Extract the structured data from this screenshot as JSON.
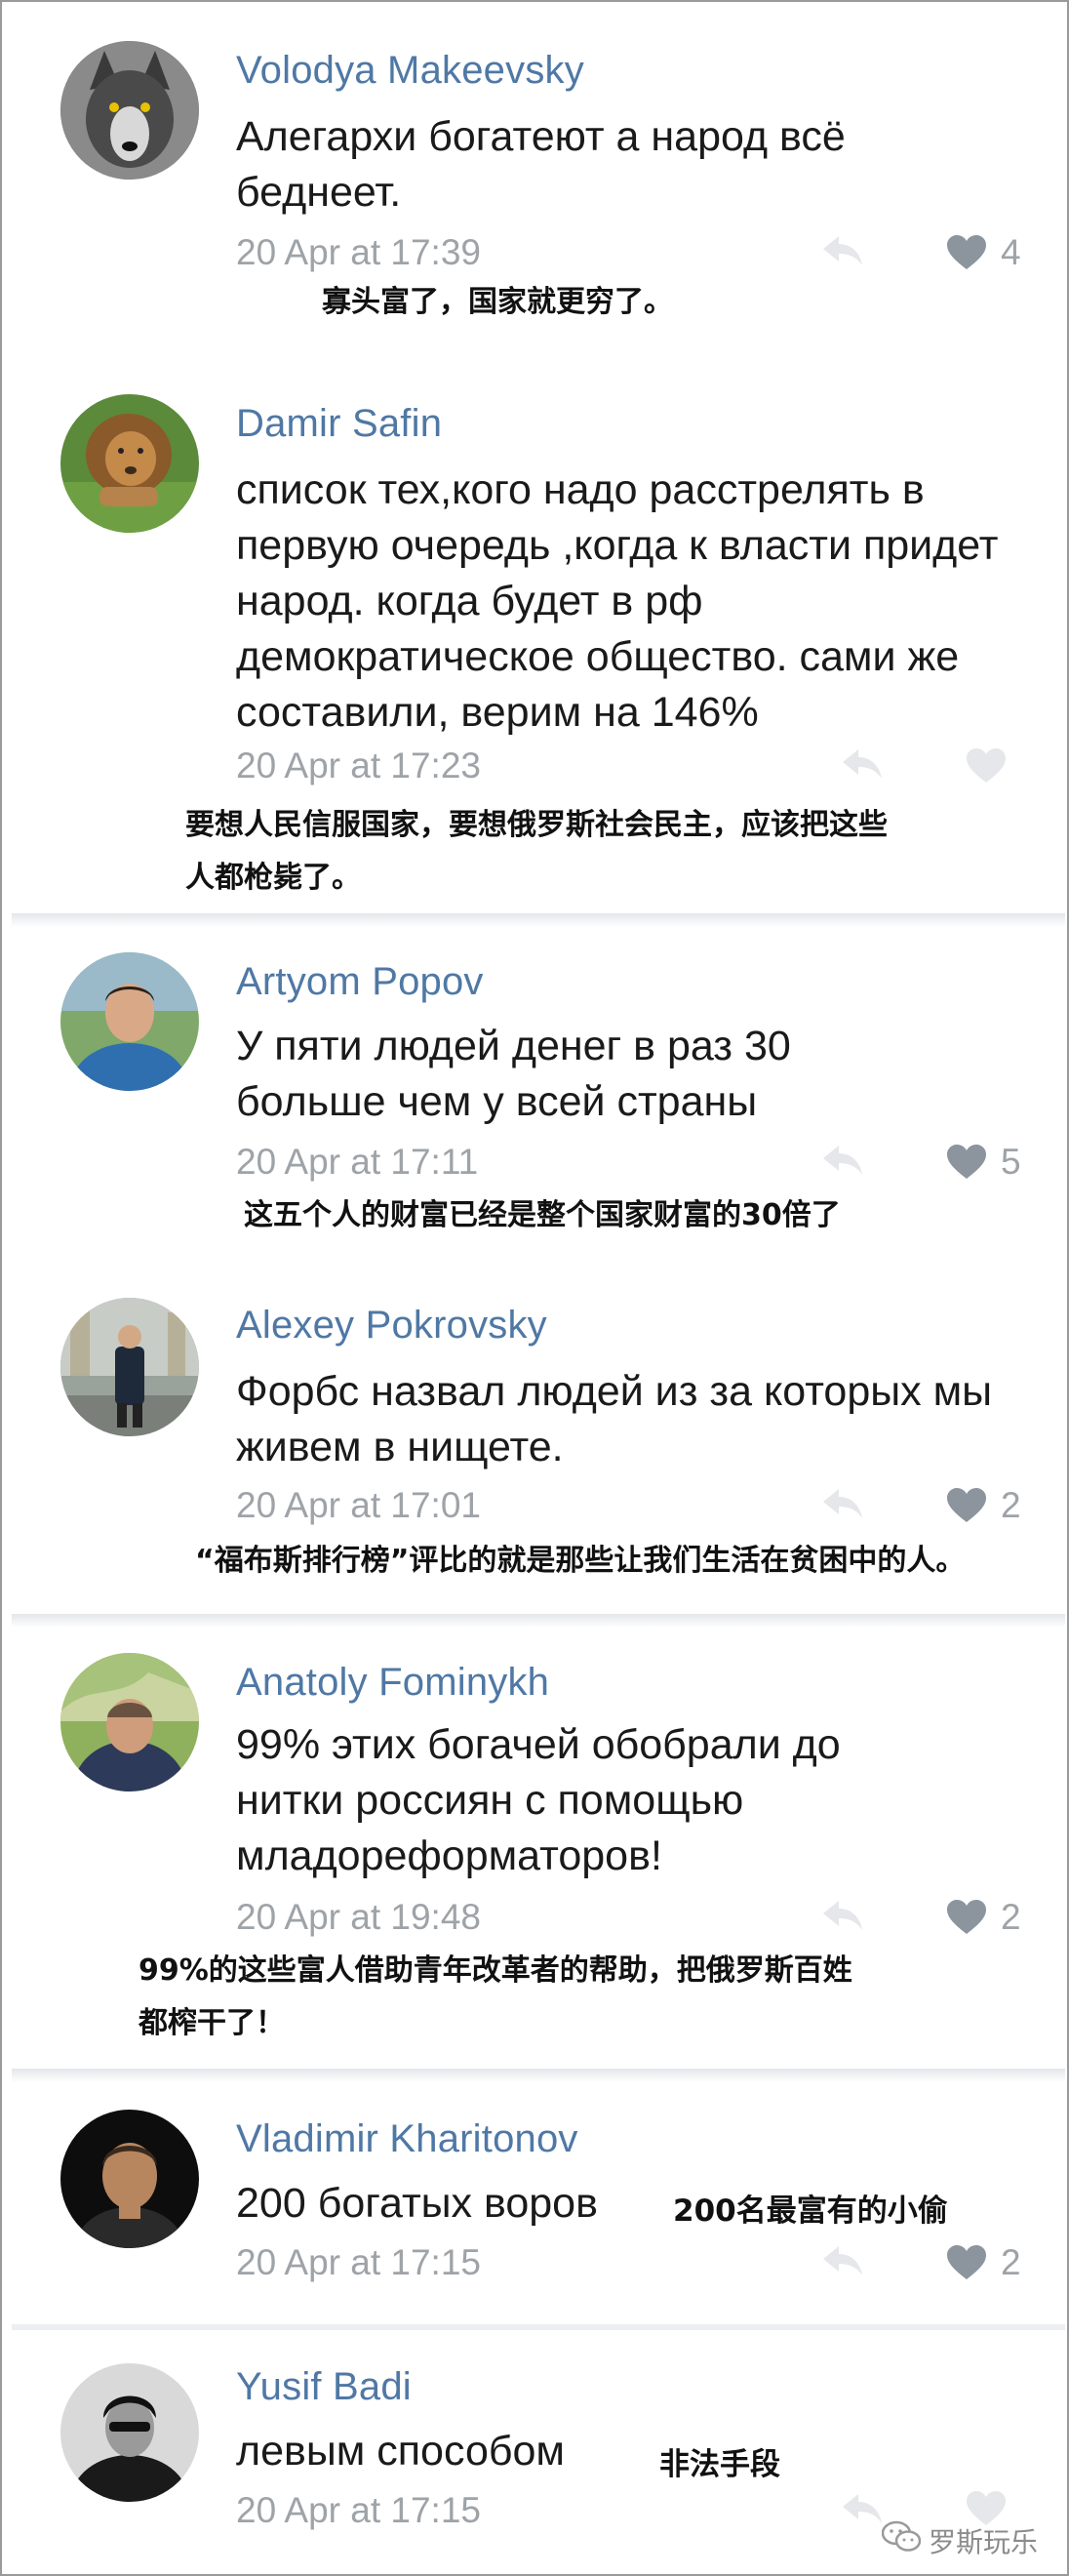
{
  "comments": [
    {
      "name": "Volodya Makeevsky",
      "text": "Алегархи богатеют а народ всё беднеет.",
      "time": "20 Apr at 17:39",
      "likes": "4",
      "translation": "寡头富了，国家就更穷了。"
    },
    {
      "name": "Damir Safin",
      "text": "список тех,кого надо расстрелять в первую очередь ,когда к власти придет народ. когда будет в рф демократическое общество. сами же составили, верим на 146%",
      "time": "20 Apr at 17:23",
      "likes": "",
      "translation_line1": "要想人民信服国家，要想俄罗斯社会民主，应该把这些",
      "translation_line2": "人都枪毙了。"
    },
    {
      "name": "Artyom Popov",
      "text": "У пяти людей денег в раз 30 больше чем у всей страны",
      "time": "20 Apr at 17:11",
      "likes": "5",
      "translation": "这五个人的财富已经是整个国家财富的30倍了"
    },
    {
      "name": "Alexey Pokrovsky",
      "text": "Форбс назвал людей из за которых мы живем в нищете.",
      "time": "20 Apr at 17:01",
      "likes": "2",
      "translation": "“福布斯排行榜”评比的就是那些让我们生活在贫困中的人。"
    },
    {
      "name": "Anatoly Fominykh",
      "text": "99% этих богачей обобрали до нитки россиян с помощью младореформаторов!",
      "time": "20 Apr at 19:48",
      "likes": "2",
      "translation_line1": "99%的这些富人借助青年改革者的帮助，把俄罗斯百姓",
      "translation_line2": "都榨干了！"
    },
    {
      "name": "Vladimir Kharitonov",
      "text": "200 богатых воров",
      "time": "20 Apr at 17:15",
      "likes": "2",
      "translation": "200名最富有的小偷"
    },
    {
      "name": "Yusif Badi",
      "text": "левым способом",
      "time": "20 Apr at 17:15",
      "likes": "",
      "translation": "非法手段"
    }
  ],
  "watermark": "罗斯玩乐",
  "colors": {
    "name": "#4f78a5",
    "meta": "#9ea3a8",
    "text": "#1a1a1a",
    "icon": "#8c959e"
  },
  "icons": [
    "reply-arrow-icon",
    "heart-icon",
    "wechat-logo-icon"
  ]
}
